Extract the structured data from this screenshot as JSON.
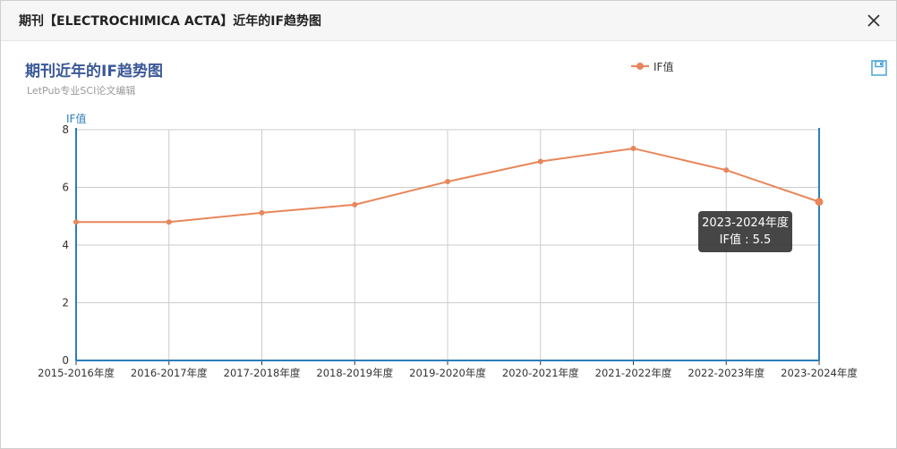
{
  "dialog": {
    "title": "期刊【ELECTROCHIMICA ACTA】近年的IF趋势图",
    "close_icon": "close-icon",
    "save_icon": "save-icon"
  },
  "chart_data": {
    "type": "line",
    "title": "期刊近年的IF趋势图",
    "subtitle": "LetPub专业SCI论文编辑",
    "ylabel": "IF值",
    "xlabel": "",
    "categories": [
      "2015-2016年度",
      "2016-2017年度",
      "2017-2018年度",
      "2018-2019年度",
      "2019-2020年度",
      "2020-2021年度",
      "2021-2022年度",
      "2022-2023年度",
      "2023-2024年度"
    ],
    "series": [
      {
        "name": "IF值",
        "values": [
          4.8,
          4.8,
          5.12,
          5.4,
          6.2,
          6.9,
          7.35,
          6.6,
          5.5
        ],
        "color": "#e8865a"
      }
    ],
    "ylim": [
      0,
      8
    ],
    "yticks": [
      "0",
      "2",
      "4",
      "6",
      "8"
    ],
    "grid": true,
    "legend_position": "top-center",
    "tooltip": {
      "category": "2023-2024年度",
      "label": "IF值 : 5.5"
    },
    "axis_color": "#2b7fb8",
    "grid_color": "#cccccc"
  }
}
